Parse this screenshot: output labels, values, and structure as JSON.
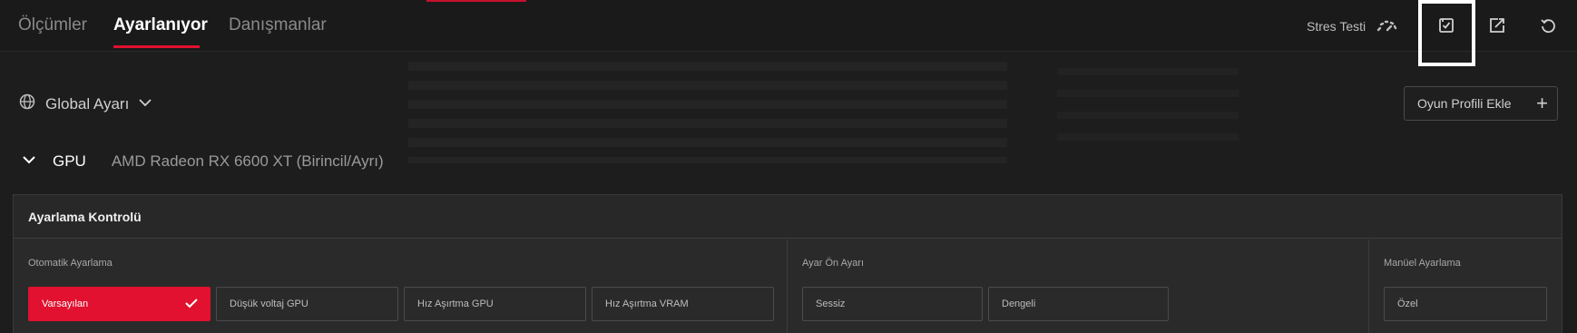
{
  "nav": {
    "tabs": [
      {
        "label": "Ölçümler"
      },
      {
        "label": "Ayarlanıyor"
      },
      {
        "label": "Danışmanlar"
      }
    ]
  },
  "toolbar": {
    "stress_test_label": "Stres Testi",
    "icons": [
      "speedometer-icon",
      "save-profile-icon",
      "export-icon",
      "reset-icon"
    ]
  },
  "profile": {
    "global_label": "Global Ayarı",
    "add_game_profile_label": "Oyun Profili Ekle"
  },
  "gpu": {
    "label": "GPU",
    "name": "AMD Radeon RX 6600 XT (Birincil/Ayrı)"
  },
  "tuning_panel": {
    "title": "Ayarlama Kontrolü",
    "auto": {
      "label": "Otomatik Ayarlama",
      "options": [
        "Varsayılan",
        "Düşük voltaj GPU",
        "Hız Aşırtma GPU",
        "Hız Aşırtma VRAM"
      ],
      "selected": "Varsayılan"
    },
    "preset": {
      "label": "Ayar Ön Ayarı",
      "options": [
        "Sessiz",
        "Dengeli"
      ]
    },
    "manual": {
      "label": "Manüel Ayarlama",
      "options": [
        "Özel"
      ]
    }
  },
  "colors": {
    "accent": "#e1112f",
    "background": "#1d1d1d",
    "panel": "#2a2a2a"
  }
}
